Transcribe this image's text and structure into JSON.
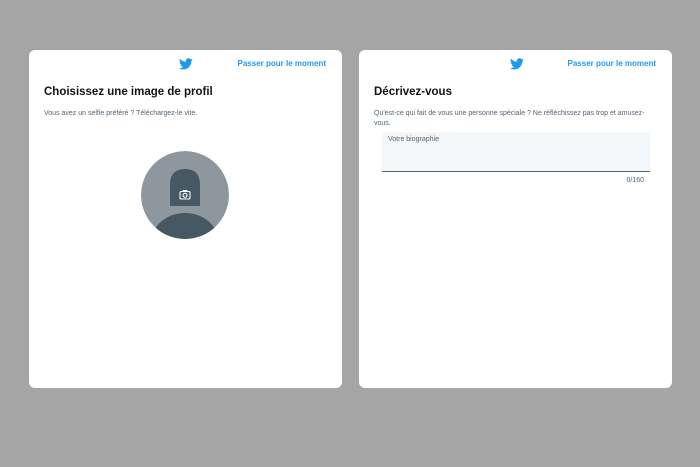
{
  "profile_image_step": {
    "logo_icon": "twitter-bird-icon",
    "skip_label": "Passer pour le moment",
    "title": "Choisissez une image de profil",
    "subtitle": "Vous avez un selfie préféré ? Téléchargez-le vite.",
    "avatar_overlay_icon": "camera-icon"
  },
  "bio_step": {
    "logo_icon": "twitter-bird-icon",
    "skip_label": "Passer pour le moment",
    "title": "Décrivez-vous",
    "subtitle": "Qu'est-ce qui fait de vous une personne spéciale ? Ne réfléchissez pas trop et amusez-vous.",
    "bio_placeholder": "Votre biographie",
    "char_counter": "0/160"
  },
  "colors": {
    "background": "#a5a5a5",
    "accent": "#1d9bf0",
    "avatar_bg": "#8f979e",
    "avatar_silhouette": "#465862"
  }
}
